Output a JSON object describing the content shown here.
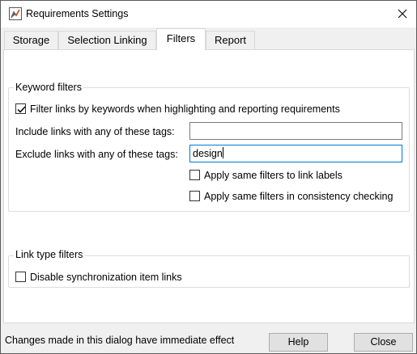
{
  "window": {
    "title": "Requirements Settings",
    "icons": {
      "app": "matlab-app-icon",
      "close": "close-icon"
    }
  },
  "tabs": [
    {
      "label": "Storage",
      "active": false
    },
    {
      "label": "Selection Linking",
      "active": false
    },
    {
      "label": "Filters",
      "active": true
    },
    {
      "label": "Report",
      "active": false
    }
  ],
  "keyword_filters": {
    "group_label": "Keyword filters",
    "filter_by_keywords": {
      "label": "Filter links by keywords when highlighting and reporting requirements",
      "checked": true
    },
    "include_tags": {
      "label": "Include links with any of these tags:",
      "value": ""
    },
    "exclude_tags": {
      "label": "Exclude links with any of these tags:",
      "value": "design"
    },
    "apply_to_labels": {
      "label": "Apply same filters to link labels",
      "checked": false
    },
    "apply_to_consistency": {
      "label": "Apply same filters in consistency checking",
      "checked": false
    }
  },
  "link_type_filters": {
    "group_label": "Link type filters",
    "disable_sync": {
      "label": "Disable synchronization item links",
      "checked": false
    }
  },
  "footer": {
    "status": "Changes made in this dialog have immediate effect",
    "help_label": "Help",
    "close_label": "Close"
  },
  "colors": {
    "focus_border": "#0078d7",
    "button_bg": "#e1e1e1",
    "window_bg": "#f0f0f0"
  }
}
